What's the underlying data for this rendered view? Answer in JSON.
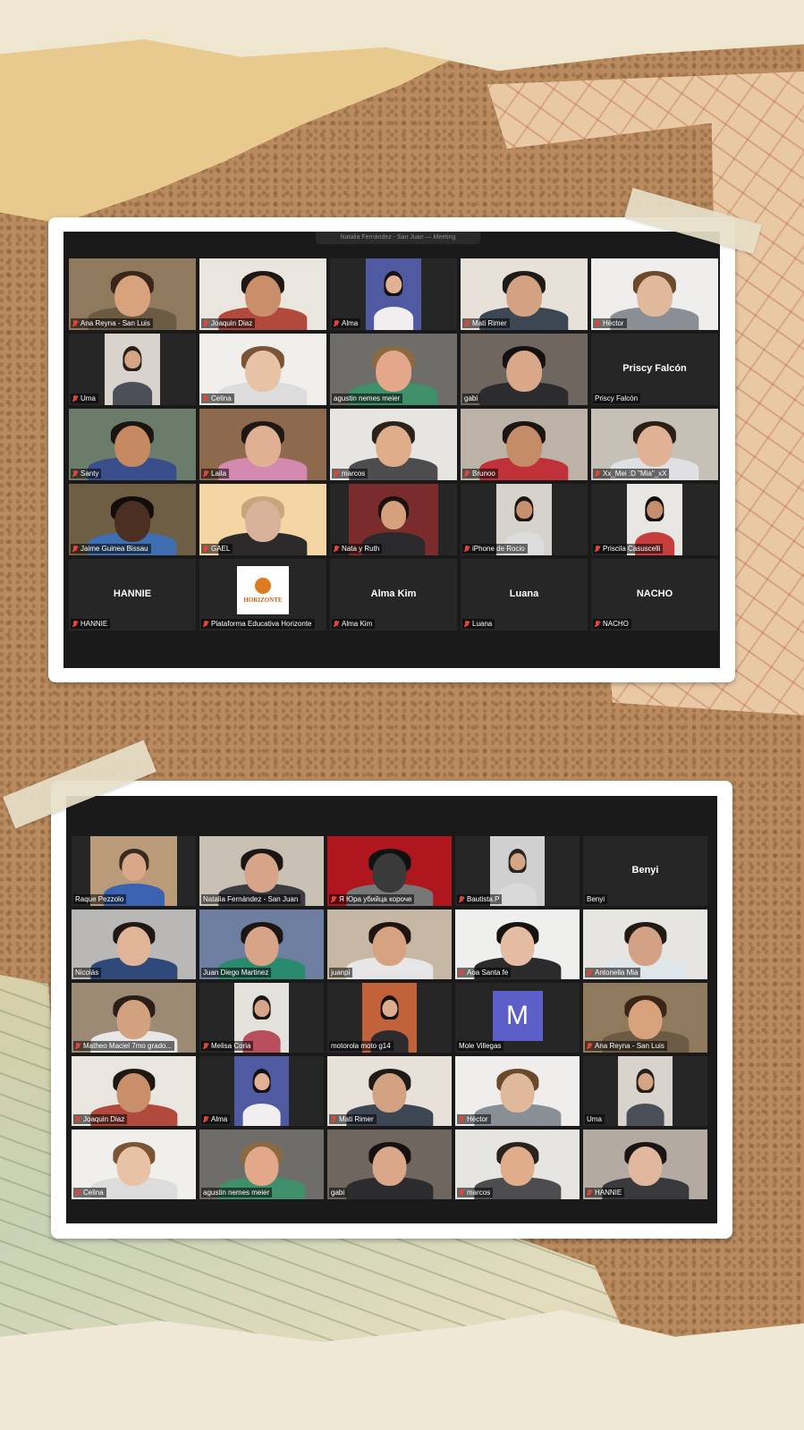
{
  "top_call": {
    "header_text": "Natalia Fernández - San Juan — Meeting",
    "tiles": [
      {
        "name": "Ana Reyna - San Luis",
        "muted": true,
        "type": "video",
        "fit": "full",
        "bg": "#8f7a5e",
        "skin": "#d8a27d",
        "hair": "#3a2518",
        "shirt": "#6b5a44"
      },
      {
        "name": "Joaquin Diaz",
        "muted": true,
        "type": "video",
        "fit": "full",
        "bg": "#e9e5df",
        "skin": "#c98f6b",
        "hair": "#1f1712",
        "shirt": "#b14a3c"
      },
      {
        "name": "Alma",
        "muted": true,
        "type": "video",
        "fit": "narrow",
        "bg": "#4f5aa0",
        "skin": "#e0b193",
        "hair": "#151018",
        "shirt": "#f1eef0"
      },
      {
        "name": "Mati Rimer",
        "muted": true,
        "type": "video",
        "fit": "full",
        "bg": "#e7e1da",
        "skin": "#d3a282",
        "hair": "#1e1a18",
        "shirt": "#3d4653"
      },
      {
        "name": "Héctor",
        "muted": true,
        "type": "video",
        "fit": "full",
        "bg": "#efeeec",
        "skin": "#e0b89b",
        "hair": "#6b4a2b",
        "shirt": "#8a8f96"
      },
      {
        "name": "Uma",
        "muted": true,
        "type": "video",
        "fit": "narrow",
        "bg": "#d8d3cc",
        "skin": "#d3a585",
        "hair": "#2a1f18",
        "shirt": "#4a4f58"
      },
      {
        "name": "Celina",
        "muted": true,
        "type": "video",
        "fit": "full",
        "bg": "#f0efec",
        "skin": "#e8c2a4",
        "hair": "#7a5434",
        "shirt": "#dcdcdc"
      },
      {
        "name": "agustin nemes meier",
        "muted": false,
        "type": "video",
        "fit": "full",
        "bg": "#6f6d69",
        "skin": "#e2a889",
        "hair": "#8a6a43",
        "shirt": "#3f8f6a"
      },
      {
        "name": "gabi",
        "muted": false,
        "type": "video",
        "fit": "full",
        "bg": "#6f6660",
        "skin": "#d9a888",
        "hair": "#141110",
        "shirt": "#2c2b2d"
      },
      {
        "name": "Priscy Falcón",
        "muted": false,
        "type": "name"
      },
      {
        "name": "Santy",
        "muted": true,
        "type": "video",
        "fit": "full",
        "bg": "#6c7c6a",
        "skin": "#c58a62",
        "hair": "#1b1512",
        "shirt": "#3a4e8c"
      },
      {
        "name": "Laila",
        "muted": true,
        "type": "video",
        "fit": "full",
        "bg": "#8d6a4e",
        "skin": "#e0b093",
        "hair": "#1e1713",
        "shirt": "#d48ab0"
      },
      {
        "name": "marcos",
        "muted": true,
        "type": "video",
        "fit": "full",
        "bg": "#e7e5e1",
        "skin": "#e0ad8b",
        "hair": "#2b221b",
        "shirt": "#4d4d50"
      },
      {
        "name": "Brunoo",
        "muted": true,
        "type": "video",
        "fit": "full",
        "bg": "#bcb2a5",
        "skin": "#c48d67",
        "hair": "#1b1410",
        "shirt": "#c0313a"
      },
      {
        "name": "Xx_Mei :D \"Mia\"_xX",
        "muted": true,
        "type": "video",
        "fit": "full",
        "bg": "#c7c0b7",
        "skin": "#e0b194",
        "hair": "#2a1e16",
        "shirt": "#dfe0e3"
      },
      {
        "name": "Jaime Guinea Bissau",
        "muted": true,
        "type": "video",
        "fit": "full",
        "bg": "#6e5f44",
        "skin": "#4a2f22",
        "hair": "#120d0b",
        "shirt": "#3f6fb0"
      },
      {
        "name": "GAEL",
        "muted": true,
        "type": "video",
        "fit": "full",
        "bg": "#f4d6a4",
        "skin": "#d8b39a",
        "hair": "#c9a47d",
        "shirt": "#2c2a2a"
      },
      {
        "name": "Nata y Ruth",
        "muted": true,
        "type": "video",
        "fit": "mid",
        "bg": "#7a2b2b",
        "skin": "#d4a17c",
        "hair": "#1a1210",
        "shirt": "#2a2a2e"
      },
      {
        "name": "iPhone de Rocio",
        "muted": true,
        "type": "video",
        "fit": "narrow",
        "bg": "#d6d2cc",
        "skin": "#c79071",
        "hair": "#1c1511",
        "shirt": "#dcdcdc"
      },
      {
        "name": "Priscila Casuscelli",
        "muted": true,
        "type": "video",
        "fit": "narrow",
        "bg": "#e8e6e3",
        "skin": "#c58f6e",
        "hair": "#100c0b",
        "shirt": "#c53d3d"
      },
      {
        "name": "HANNIE",
        "muted": true,
        "type": "name"
      },
      {
        "name": "Plataforma Educativa Horizonte",
        "muted": true,
        "type": "logo",
        "logo_text": "HORIZONTE"
      },
      {
        "name": "Alma Kim",
        "muted": true,
        "type": "name"
      },
      {
        "name": "Luana",
        "muted": true,
        "type": "name"
      },
      {
        "name": "NACHO",
        "muted": true,
        "type": "name"
      }
    ]
  },
  "bottom_call": {
    "tiles": [
      {
        "name": "Raque Pezzolo",
        "muted": false,
        "type": "video",
        "fit": "mid",
        "bg": "#b99b79",
        "skin": "#d8a889",
        "hair": "#3b2a1d",
        "shirt": "#3b62b0"
      },
      {
        "name": "Natalia Fernández - San Juan",
        "muted": false,
        "type": "video",
        "fit": "full",
        "active": true,
        "bg": "#c9c1b4",
        "skin": "#d6a589",
        "hair": "#1c1612",
        "shirt": "#3b3b40"
      },
      {
        "name": "Я Юра убийца короче",
        "muted": true,
        "type": "video",
        "fit": "full",
        "bg": "#b0161d",
        "skin": "#3a3a3a",
        "hair": "#111111",
        "shirt": "#777777"
      },
      {
        "name": "Bautista.P",
        "muted": true,
        "type": "video",
        "fit": "narrow",
        "bg": "#cfd0cf",
        "skin": "#d3a688",
        "hair": "#2a2320",
        "shirt": "#d9d9d9"
      },
      {
        "name": "Benyi",
        "muted": false,
        "type": "name"
      },
      {
        "name": "Nicolás",
        "muted": false,
        "type": "video",
        "fit": "full",
        "bg": "#b9b8b6",
        "skin": "#e0b497",
        "hair": "#201812",
        "shirt": "#2f4a7a"
      },
      {
        "name": "Juan Diego Martinez",
        "muted": false,
        "type": "video",
        "fit": "full",
        "bg": "#6e7ea1",
        "skin": "#d7a487",
        "hair": "#1c1612",
        "shirt": "#2a8a6d"
      },
      {
        "name": "juanpi",
        "muted": false,
        "type": "video",
        "fit": "full",
        "bg": "#c7b8a5",
        "skin": "#d7a281",
        "hair": "#1e1511",
        "shirt": "#e6e6e6"
      },
      {
        "name": "Aoa  Santa fe",
        "muted": true,
        "type": "video",
        "fit": "full",
        "bg": "#efefed",
        "skin": "#e3bca2",
        "hair": "#151210",
        "shirt": "#2b2b2d"
      },
      {
        "name": "Antonella Mia",
        "muted": true,
        "type": "video",
        "fit": "full",
        "bg": "#e6e5e2",
        "skin": "#d3a285",
        "hair": "#241a14",
        "shirt": "#dfe6ea"
      },
      {
        "name": "Matheo Maciel 7mo grado...",
        "muted": true,
        "type": "video",
        "fit": "full",
        "bg": "#9c8a74",
        "skin": "#d2a17f",
        "hair": "#2a2018",
        "shirt": "#e7e7e7"
      },
      {
        "name": "Melisa Coria",
        "muted": true,
        "type": "video",
        "fit": "narrow",
        "bg": "#e3e1dc",
        "skin": "#d7a68a",
        "hair": "#1e1612",
        "shirt": "#b84f5d"
      },
      {
        "name": "motorola moto g14",
        "muted": false,
        "type": "video",
        "fit": "narrow",
        "bg": "#c1623b",
        "skin": "#dcae8f",
        "hair": "#15110f",
        "shirt": "#2c2c2f"
      },
      {
        "name": "Mole Villegas",
        "muted": false,
        "type": "avatar",
        "initial": "M"
      },
      {
        "name": "Ana Reyna - San Luis",
        "muted": true,
        "type": "video",
        "fit": "full",
        "bg": "#8f7a5e",
        "skin": "#d8a27d",
        "hair": "#3a2518",
        "shirt": "#6b5a44"
      },
      {
        "name": "Joaquin Diaz",
        "muted": true,
        "type": "video",
        "fit": "full",
        "bg": "#e9e5df",
        "skin": "#c98f6b",
        "hair": "#1f1712",
        "shirt": "#b14a3c"
      },
      {
        "name": "Alma",
        "muted": true,
        "type": "video",
        "fit": "narrow",
        "bg": "#4f5aa0",
        "skin": "#e0b193",
        "hair": "#151018",
        "shirt": "#f1eef0"
      },
      {
        "name": "Mati Rimer",
        "muted": true,
        "type": "video",
        "fit": "full",
        "bg": "#e7e1da",
        "skin": "#d3a282",
        "hair": "#1e1a18",
        "shirt": "#3d4653"
      },
      {
        "name": "Héctor",
        "muted": true,
        "type": "video",
        "fit": "full",
        "bg": "#efeeec",
        "skin": "#e0b89b",
        "hair": "#6b4a2b",
        "shirt": "#8a8f96"
      },
      {
        "name": "Uma",
        "muted": false,
        "type": "video",
        "fit": "narrow",
        "bg": "#d8d3cc",
        "skin": "#d3a585",
        "hair": "#2a1f18",
        "shirt": "#4a4f58"
      },
      {
        "name": "Celina",
        "muted": true,
        "type": "video",
        "fit": "full",
        "bg": "#f0efec",
        "skin": "#e8c2a4",
        "hair": "#7a5434",
        "shirt": "#dcdcdc"
      },
      {
        "name": "agustin nemes meier",
        "muted": false,
        "type": "video",
        "fit": "full",
        "bg": "#6f6d69",
        "skin": "#e2a889",
        "hair": "#8a6a43",
        "shirt": "#3f8f6a"
      },
      {
        "name": "gabi",
        "muted": false,
        "type": "video",
        "fit": "full",
        "bg": "#6f6660",
        "skin": "#d9a888",
        "hair": "#141110",
        "shirt": "#2c2b2d"
      },
      {
        "name": "marcos",
        "muted": true,
        "type": "video",
        "fit": "full",
        "bg": "#e7e5e1",
        "skin": "#e0ad8b",
        "hair": "#2b221b",
        "shirt": "#4d4d50"
      },
      {
        "name": "HANNIE",
        "muted": true,
        "type": "video",
        "fit": "full",
        "bg": "#b3aba2",
        "skin": "#e1b79d",
        "hair": "#1a1412",
        "shirt": "#3a3a3e"
      }
    ]
  }
}
